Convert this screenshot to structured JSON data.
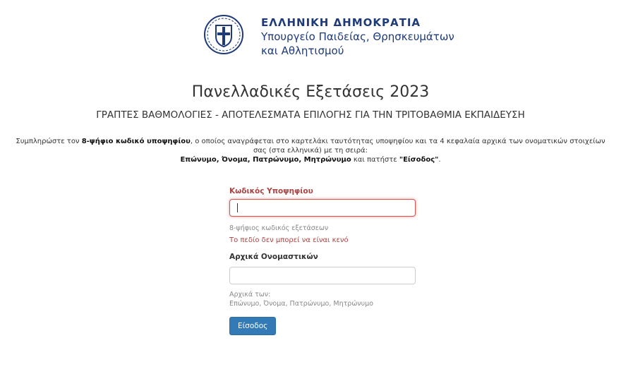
{
  "header": {
    "republic": "ΕΛΛΗΝΙΚΗ ΔΗΜΟΚΡΑΤΙΑ",
    "ministry_line1": "Υπουργείο Παιδείας, Θρησκευμάτων",
    "ministry_line2": "και Αθλητισμού"
  },
  "page": {
    "title": "Πανελλαδικές Εξετάσεις 2023",
    "subtitle": "ΓΡΑΠΤΕΣ ΒΑΘΜΟΛΟΓΙΕΣ - ΑΠΟΤΕΛΕΣΜΑΤΑ ΕΠΙΛΟΓΗΣ ΓΙΑ ΤΗΝ ΤΡΙΤΟΒΑΘΜΙΑ ΕΚΠΑΙΔΕΥΣΗ"
  },
  "instructions": {
    "part1": "Συμπληρώστε τον ",
    "bold1": "8-ψήφιο κωδικό υποψηφίου",
    "part2": ", ο οποίος αναγράφεται στο καρτελάκι ταυτότητας υποψηφίου και τα 4 κεφαλαία αρχικά των ονοματικών στοιχείων σας (στα ελληνικά) με τη σειρά:",
    "bold2": "Επώνυμο, Όνομα, Πατρώνυμο, Μητρώνυμο",
    "part3": " και πατήστε ",
    "bold3": "\"Είσοδος\"",
    "part4": "."
  },
  "form": {
    "code_label": "Κωδικός Υποψηφίου",
    "code_value": "",
    "code_help": "8-ψήφιος κωδικός εξετάσεων",
    "code_error": "Το πεδίο δεν μπορεί να είναι κενό",
    "initials_label": "Αρχικά Ονομαστικών",
    "initials_value": "",
    "initials_help_line1": "Αρχικά των:",
    "initials_help_line2": "Επώνυμο, Όνομα, Πατρώνυμο, Μητρώνυμο",
    "submit_label": "Είσοδος"
  },
  "colors": {
    "brand": "#1e3a78",
    "error": "#a94442",
    "primary_button": "#337ab7"
  },
  "icons": {
    "logo": "greek-coat-of-arms-icon"
  }
}
